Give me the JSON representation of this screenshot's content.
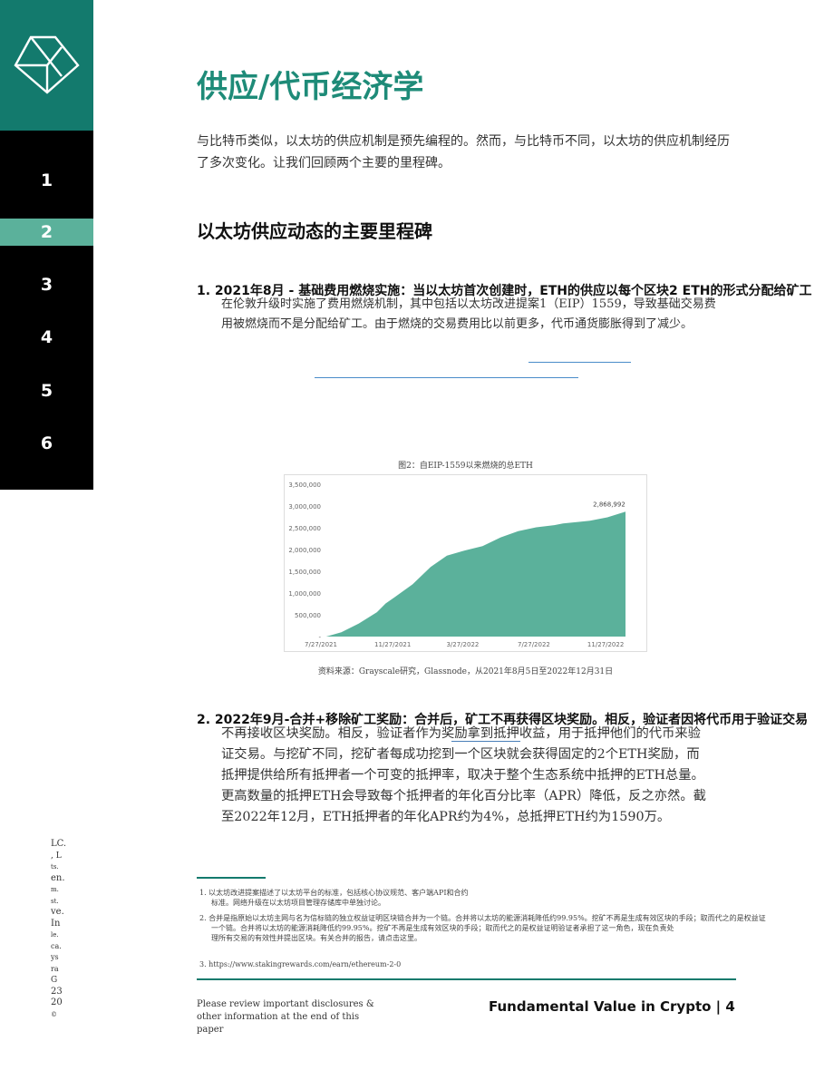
{
  "nav": {
    "items": [
      "1",
      "2",
      "3",
      "4",
      "5",
      "6"
    ],
    "active_index": 1
  },
  "title": "供应/代币经济学",
  "intro": "与比特币类似，以太坊的供应机制是预先编程的。然而，与比特币不同，以太坊的供应机制经历了多次变化。让我们回顾两个主要的里程碑。",
  "section_heading": "以太坊供应动态的主要里程碑",
  "item1": {
    "head": "1. 2021年8月 - 基础费用燃烧实施：当以太坊首次创建时，ETH的供应以每个区块2 ETH的形式分配给矿工",
    "lines": [
      "在伦敦升级时实施了费用燃烧机制，其中包括以太坊改进提案1（EIP）1559，导致基础交易费",
      "用被燃烧而不是分配给矿工。由于燃烧的交易费用比以前更多，代币通货膨胀得到了减少。"
    ]
  },
  "figure": {
    "caption": "图2：自EIP-1559以来燃烧的总ETH",
    "source": "资料来源：Grayscale研究，Glassnode，从2021年8月5日至2022年12月31日"
  },
  "chart_data": {
    "type": "area",
    "title": "",
    "xlabel": "",
    "ylabel": "",
    "x_ticks": [
      "7/27/2021",
      "11/27/2021",
      "3/27/2022",
      "7/27/2022",
      "11/27/2022"
    ],
    "y_ticks": [
      "-",
      "500,000",
      "1,000,000",
      "1,500,000",
      "2,000,000",
      "2,500,000",
      "3,000,000",
      "3,500,000"
    ],
    "ylim": [
      0,
      3500000
    ],
    "grid": false,
    "color": "#5bb19b",
    "end_label": "2,868,992",
    "series": [
      {
        "x": [
          "2021-08-05",
          "2021-08-31",
          "2021-09-30",
          "2021-10-31",
          "2021-11-15",
          "2021-11-30",
          "2021-12-31",
          "2022-01-31",
          "2022-02-28",
          "2022-03-31",
          "2022-04-30",
          "2022-05-31",
          "2022-06-30",
          "2022-07-31",
          "2022-08-31",
          "2022-09-15",
          "2022-10-31",
          "2022-11-30",
          "2022-12-31"
        ],
        "values": [
          0,
          100000,
          300000,
          560000,
          760000,
          900000,
          1200000,
          1600000,
          1860000,
          1980000,
          2080000,
          2280000,
          2420000,
          2510000,
          2560000,
          2600000,
          2660000,
          2740000,
          2868992
        ]
      }
    ]
  },
  "item2": {
    "head": "2. 2022年9月-合并+移除矿工奖励：合并后，矿工不再获得区块奖励。相反，验证者因将代币用于验证交易",
    "lines": [
      "不再接收区块奖励。相反，验证者作为奖励拿到抵押收益，用于抵押他们的代币来验",
      "证交易。与挖矿不同，挖矿者每成功挖到一个区块就会获得固定的2个ETH奖励，而",
      "抵押提供给所有抵押者一个可变的抵押率，取决于整个生态系统中抵押的ETH总量。",
      "更高数量的抵押ETH会导致每个抵押者的年化百分比率（APR）降低，反之亦然。截",
      "至2022年12月，ETH抵押者的年化APR约为4%，总抵押ETH约为1590万。"
    ]
  },
  "side_text": [
    "LC.",
    ", L",
    "ts.",
    "en.",
    "m.",
    "st.",
    "ve.",
    "In",
    "le.",
    "ca.",
    "ys",
    "ra",
    "G",
    "23",
    "20",
    "©"
  ],
  "footnotes": {
    "fn1": [
      "1. 以太坊改进提案描述了以太坊平台的标准，包括核心协议规范、客户端API和合约",
      "标准。网络升级在以太坊项目管理存储库中单独讨论。"
    ],
    "fn2": [
      "2. 合并是指原始以太坊主网与名为信标链的独立权益证明区块链合并为一个链。合并将以太坊的能源消耗降低约99.95%。挖矿不再是生成有效区块的手段；取而代之的是权益证",
      "一个链。合并将以太坊的能源消耗降低约99.95%。挖矿不再是生成有效区块的手段；取而代之的是权益证明验证者承担了这一角色，现在负责处",
      "理所有交易的有效性并提出区块。有关合并的报告，请点击这里。"
    ],
    "fn3": "3. https://www.stakingrewards.com/earn/ethereum-2-0"
  },
  "footer": {
    "disclaimer": "Please review important disclosures & other information at the end of this paper",
    "page_label": "Fundamental Value in Crypto | 4"
  }
}
